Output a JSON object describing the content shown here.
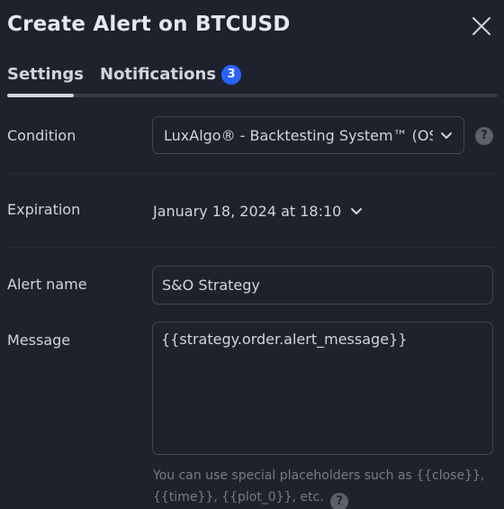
{
  "dialog": {
    "title": "Create Alert on BTCUSD",
    "close_icon": "close-icon"
  },
  "tabs": [
    {
      "label": "Settings",
      "active": true
    },
    {
      "label": "Notifications",
      "badge": "3"
    }
  ],
  "form": {
    "condition": {
      "label": "Condition",
      "value": "LuxAlgo® - Backtesting System™ (OS...",
      "icon": "chevron-down-icon"
    },
    "expiration": {
      "label": "Expiration",
      "value": "January 18, 2024 at 18:10",
      "icon": "chevron-down-icon"
    },
    "alert_name": {
      "label": "Alert name",
      "value": "S&O Strategy"
    },
    "message": {
      "label": "Message",
      "value": "{{strategy.order.alert_message}}",
      "hint": "You can use special placeholders such as {{close}}, {{time}}, {{plot_0}}, etc."
    },
    "help_glyph": "?"
  },
  "colors": {
    "background": "#1e222d",
    "accent": "#2962ff",
    "text": "#d1d4dc",
    "muted": "#787b86",
    "border": "#434651"
  }
}
